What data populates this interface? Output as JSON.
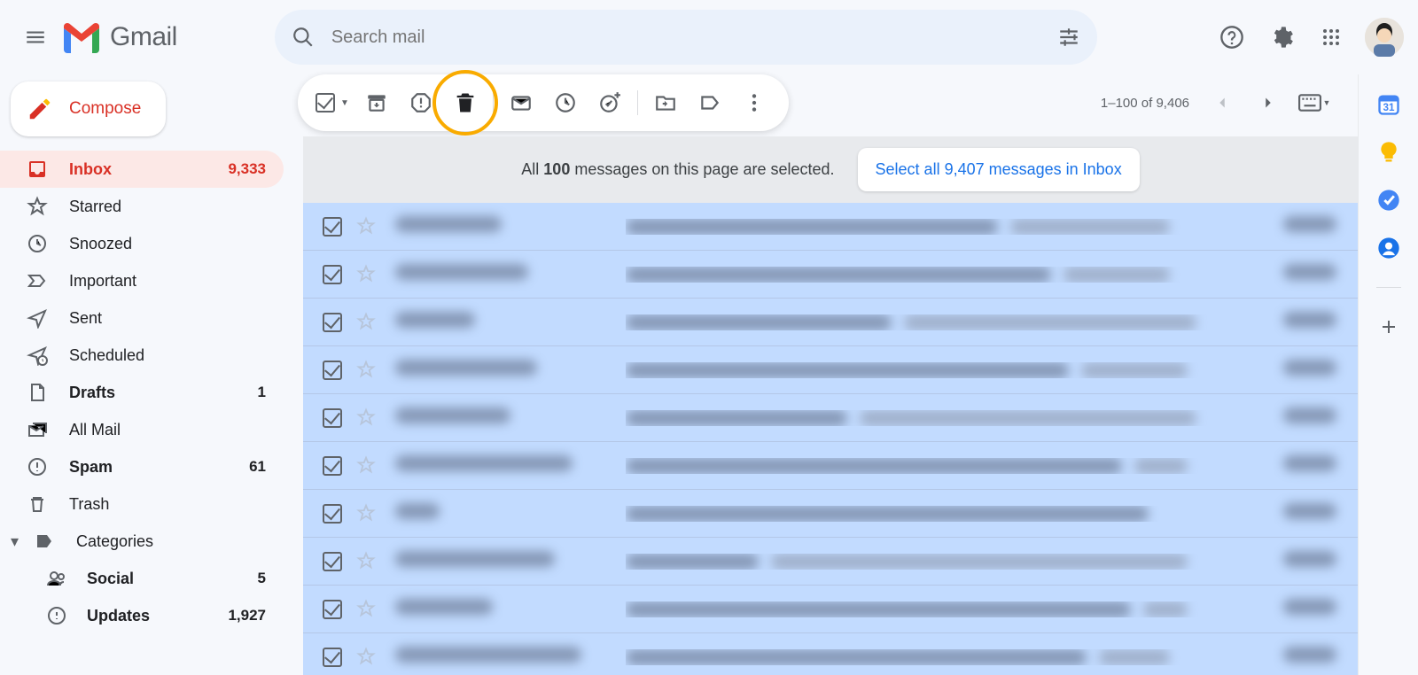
{
  "header": {
    "logo_text": "Gmail",
    "search_placeholder": "Search mail"
  },
  "compose_label": "Compose",
  "sidebar": {
    "items": [
      {
        "label": "Inbox",
        "count": "9,333"
      },
      {
        "label": "Starred",
        "count": ""
      },
      {
        "label": "Snoozed",
        "count": ""
      },
      {
        "label": "Important",
        "count": ""
      },
      {
        "label": "Sent",
        "count": ""
      },
      {
        "label": "Scheduled",
        "count": ""
      },
      {
        "label": "Drafts",
        "count": "1"
      },
      {
        "label": "All Mail",
        "count": ""
      },
      {
        "label": "Spam",
        "count": "61"
      },
      {
        "label": "Trash",
        "count": ""
      },
      {
        "label": "Categories",
        "count": ""
      }
    ],
    "subs": [
      {
        "label": "Social",
        "count": "5"
      },
      {
        "label": "Updates",
        "count": "1,927"
      }
    ]
  },
  "toolbar": {
    "page_info": "1–100 of 9,406"
  },
  "banner": {
    "prefix": "All ",
    "count": "100",
    "suffix": " messages on this page are selected.",
    "select_all": "Select all 9,407 messages in Inbox"
  },
  "messages": {
    "rows": 10
  }
}
